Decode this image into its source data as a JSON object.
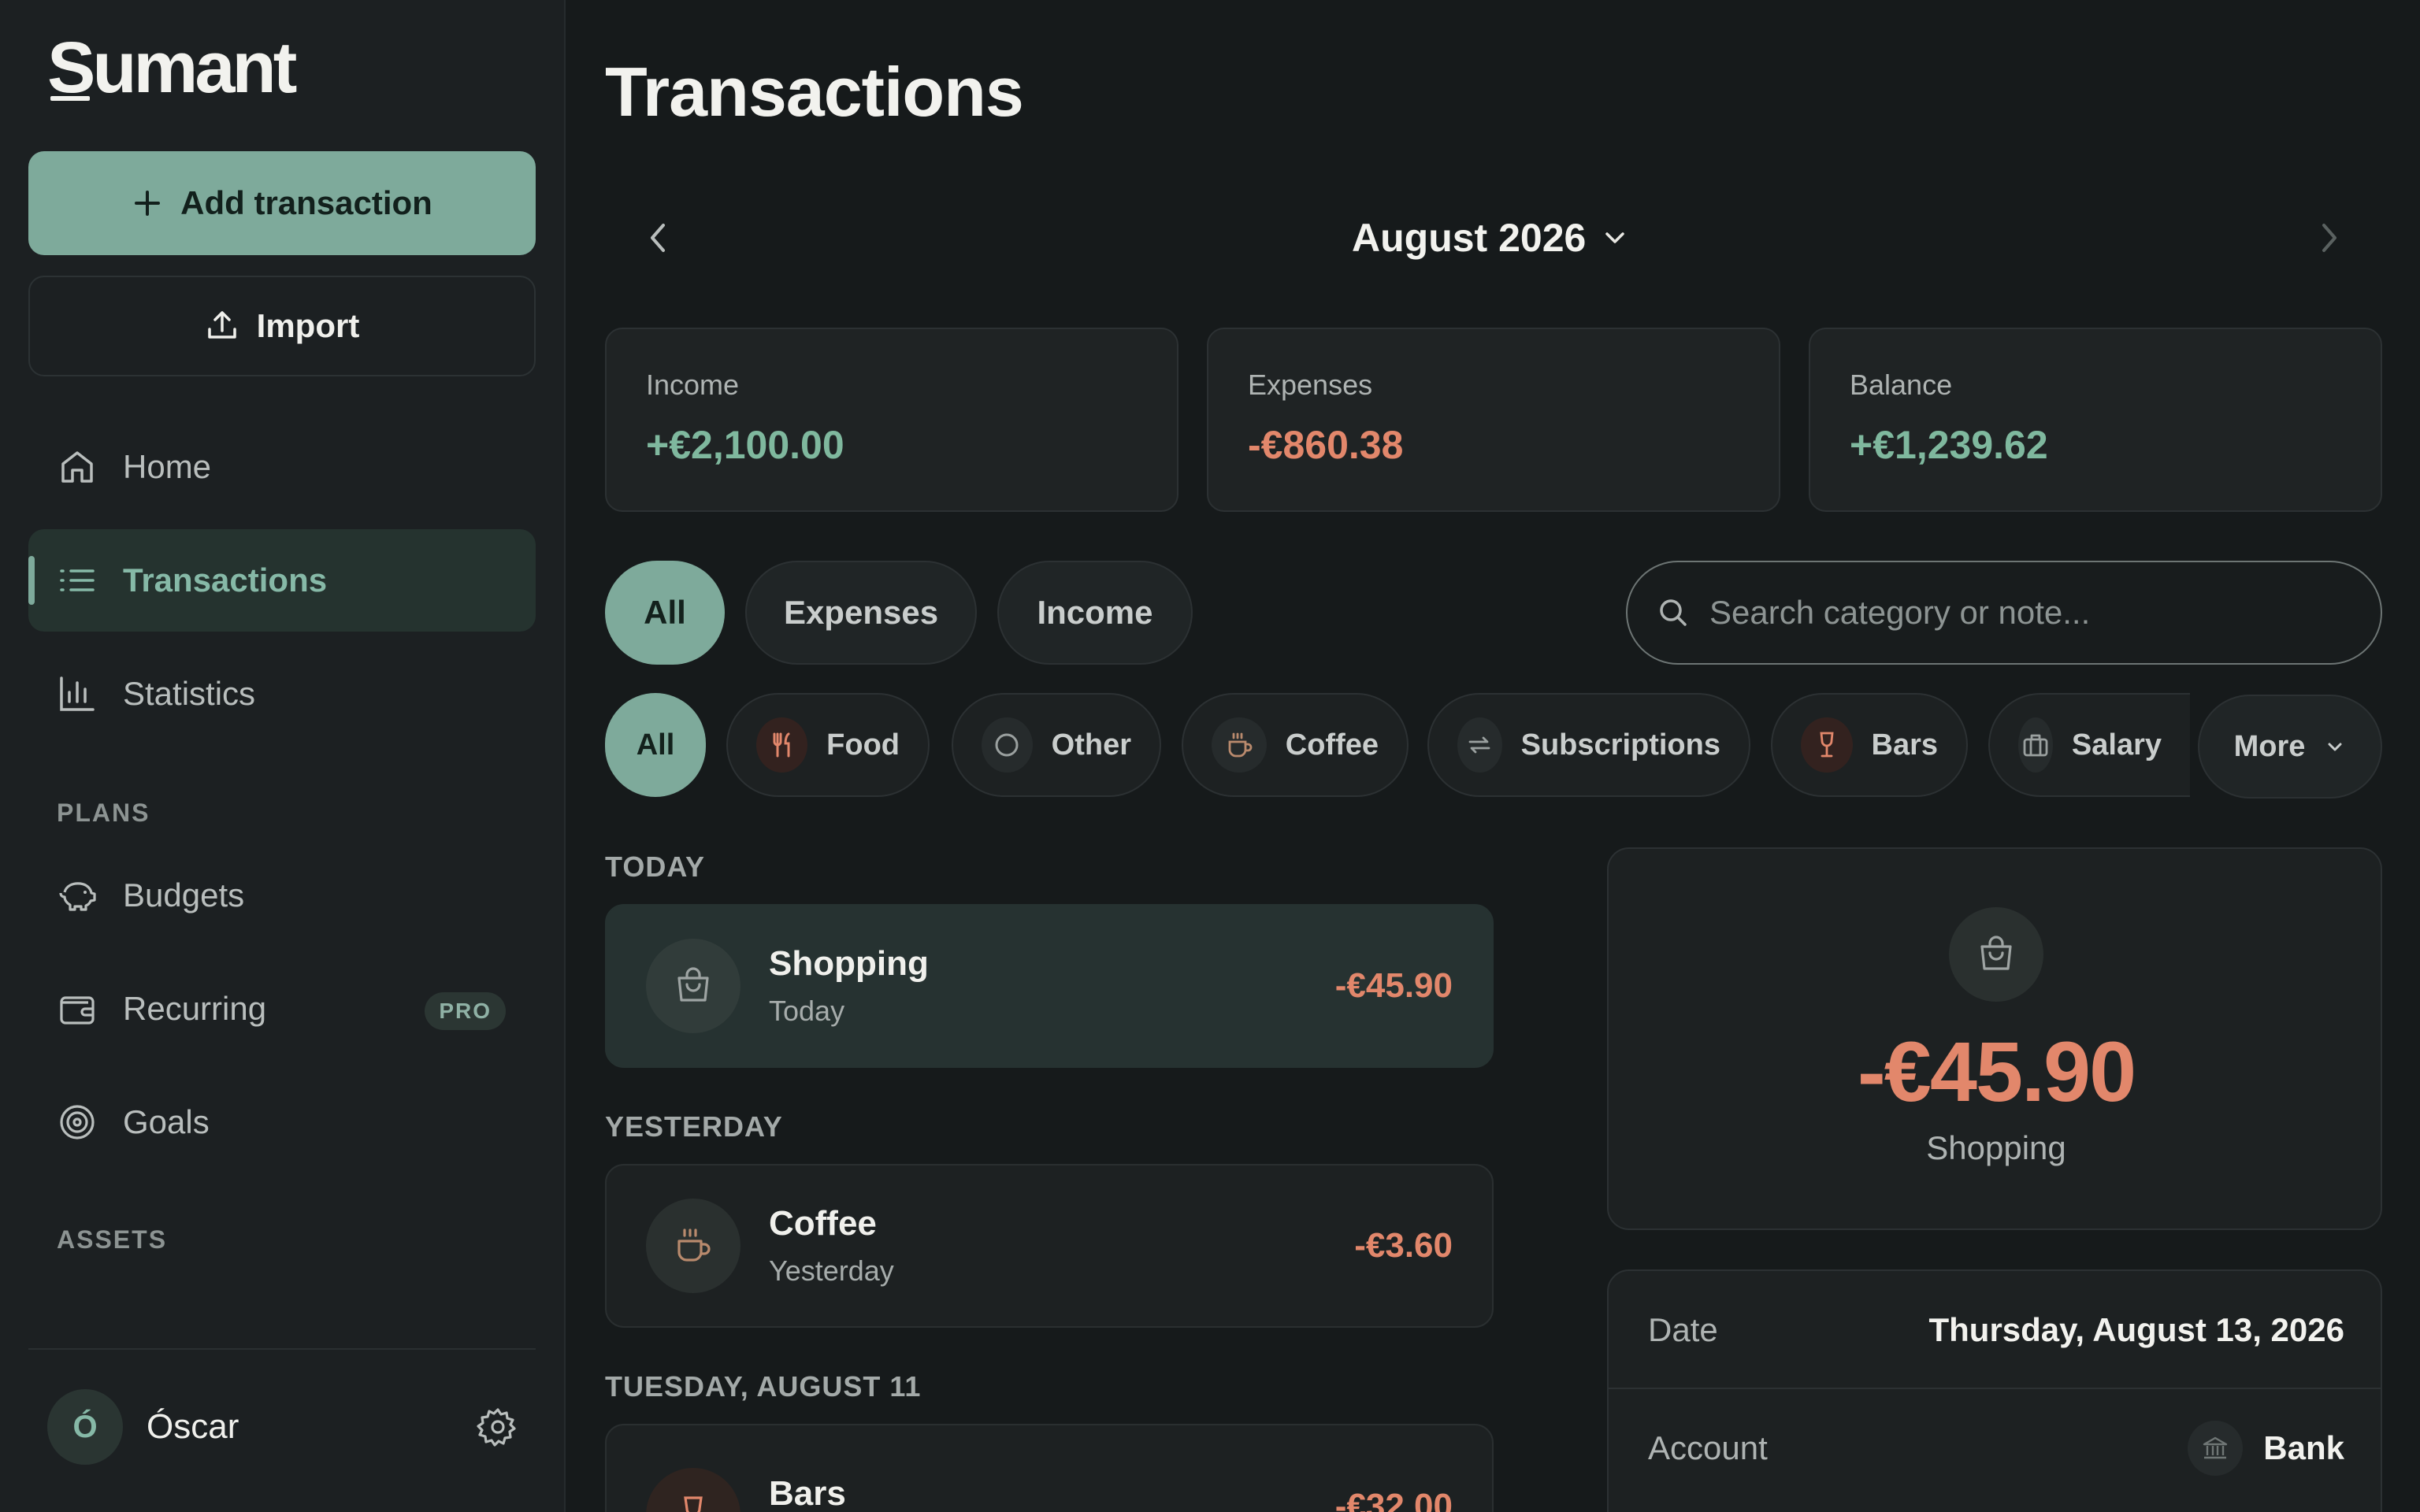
{
  "app": {
    "logo": "Sumant"
  },
  "sidebar": {
    "add_label": "Add transaction",
    "import_label": "Import",
    "nav": [
      {
        "label": "Home",
        "icon": "home-icon"
      },
      {
        "label": "Transactions",
        "icon": "list-icon",
        "active": true
      },
      {
        "label": "Statistics",
        "icon": "bar-chart-icon"
      }
    ],
    "plans_label": "PLANS",
    "plans": [
      {
        "label": "Budgets",
        "icon": "piggy-bank-icon"
      },
      {
        "label": "Recurring",
        "icon": "wallet-icon",
        "badge": "PRO"
      },
      {
        "label": "Goals",
        "icon": "target-icon"
      }
    ],
    "assets_label": "ASSETS",
    "user": {
      "initial": "Ó",
      "name": "Óscar"
    }
  },
  "main": {
    "title": "Transactions",
    "month": "August 2026",
    "stats": [
      {
        "label": "Income",
        "value": "+€2,100.00",
        "tone": "positive"
      },
      {
        "label": "Expenses",
        "value": "-€860.38",
        "tone": "negative"
      },
      {
        "label": "Balance",
        "value": "+€1,239.62",
        "tone": "positive"
      }
    ],
    "type_filters": [
      "All",
      "Expenses",
      "Income"
    ],
    "search": {
      "placeholder": "Search category or note..."
    },
    "category_filters": [
      "All",
      "Food",
      "Other",
      "Coffee",
      "Subscriptions",
      "Bars",
      "Salary"
    ],
    "more_label": "More",
    "groups": [
      {
        "label": "TODAY",
        "items": [
          {
            "title": "Shopping",
            "sub": "Today",
            "amount": "-€45.90",
            "icon": "shopping-bag-icon"
          }
        ]
      },
      {
        "label": "YESTERDAY",
        "items": [
          {
            "title": "Coffee",
            "sub": "Yesterday",
            "amount": "-€3.60",
            "icon": "coffee-cup-icon"
          }
        ]
      },
      {
        "label": "TUESDAY, AUGUST 11",
        "items": [
          {
            "title": "Bars",
            "sub": "",
            "amount": "-€32.00",
            "icon": "wine-glass-icon"
          }
        ]
      }
    ]
  },
  "detail": {
    "amount": "-€45.90",
    "category": "Shopping",
    "date_label": "Date",
    "date_value": "Thursday, August 13, 2026",
    "account_label": "Account",
    "account_value": "Bank"
  },
  "colors": {
    "accent": "#7eaa9b",
    "positive": "#7fb89e",
    "negative": "#e2876b",
    "background": "#161a1b"
  }
}
